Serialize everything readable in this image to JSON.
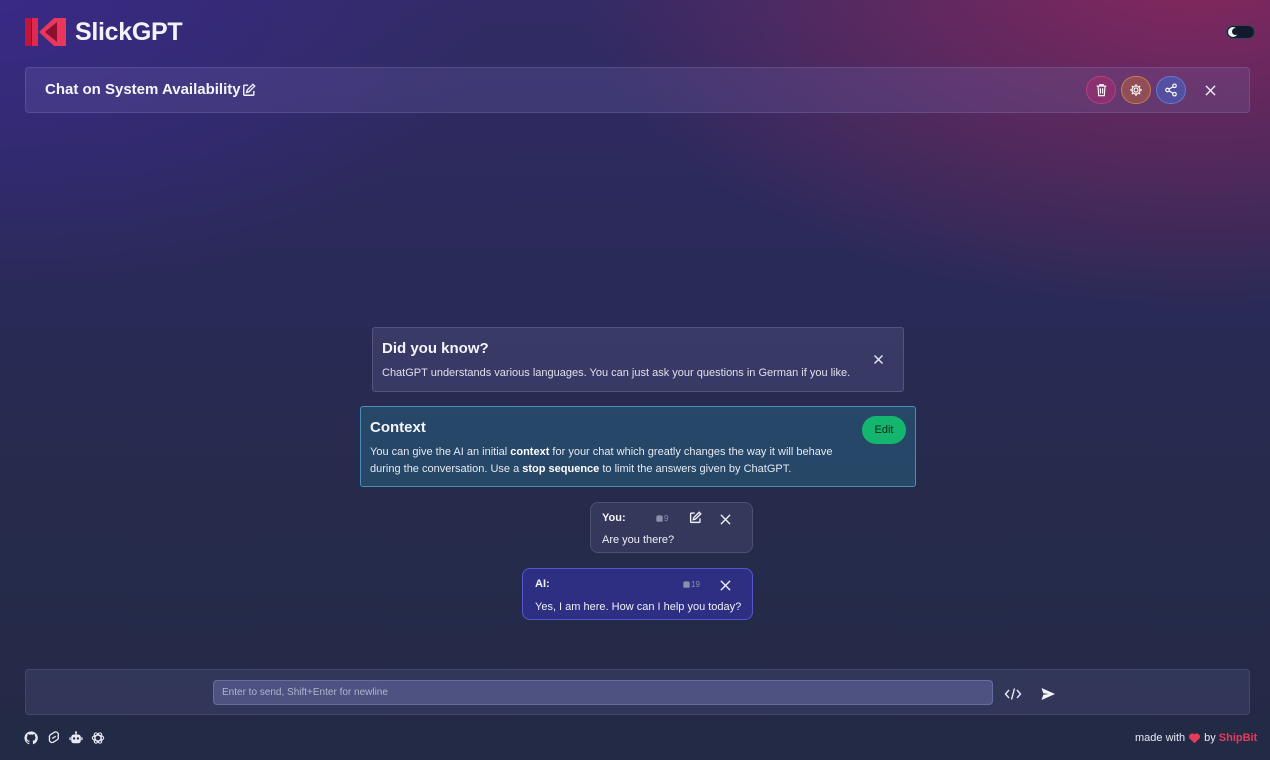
{
  "app": {
    "name": "SlickGPT"
  },
  "chat": {
    "title": "Chat on System Availability"
  },
  "tip": {
    "title": "Did you know?",
    "text": "ChatGPT understands various languages. You can just ask your questions in German if you like."
  },
  "context": {
    "title": "Context",
    "text_1": "You can give the AI an initial ",
    "bold_1": "context",
    "text_2": " for your chat which greatly changes the way it will behave during the conversation. Use a ",
    "bold_2": "stop sequence",
    "text_3": " to limit the answers given by ChatGPT.",
    "edit_label": "Edit"
  },
  "messages": [
    {
      "sender": "You:",
      "tokens": "9",
      "text": "Are you there?"
    },
    {
      "sender": "AI:",
      "tokens": "19",
      "text": "Yes, I am here. How can I help you today?"
    }
  ],
  "input": {
    "placeholder": "Enter to send, Shift+Enter for newline"
  },
  "footer": {
    "made_with": "made with",
    "by": "by",
    "brand": "ShipBit"
  },
  "colors": {
    "accent_green": "#14b56f",
    "brand_red": "#e53b5b",
    "context_border": "#50aad2",
    "ai_bubble": "#32329a"
  },
  "icons": {
    "logo": "slickgpt-logo-icon",
    "title_edit": "pencil-square-icon",
    "delete": "trash-icon",
    "settings": "gear-icon",
    "share": "share-icon",
    "close": "close-icon",
    "tokens": "database-icon",
    "code": "code-icon",
    "send": "paper-plane-icon",
    "footer": [
      "github-icon",
      "svelte-icon",
      "robot-icon",
      "openai-icon"
    ],
    "heart": "heart-icon"
  }
}
